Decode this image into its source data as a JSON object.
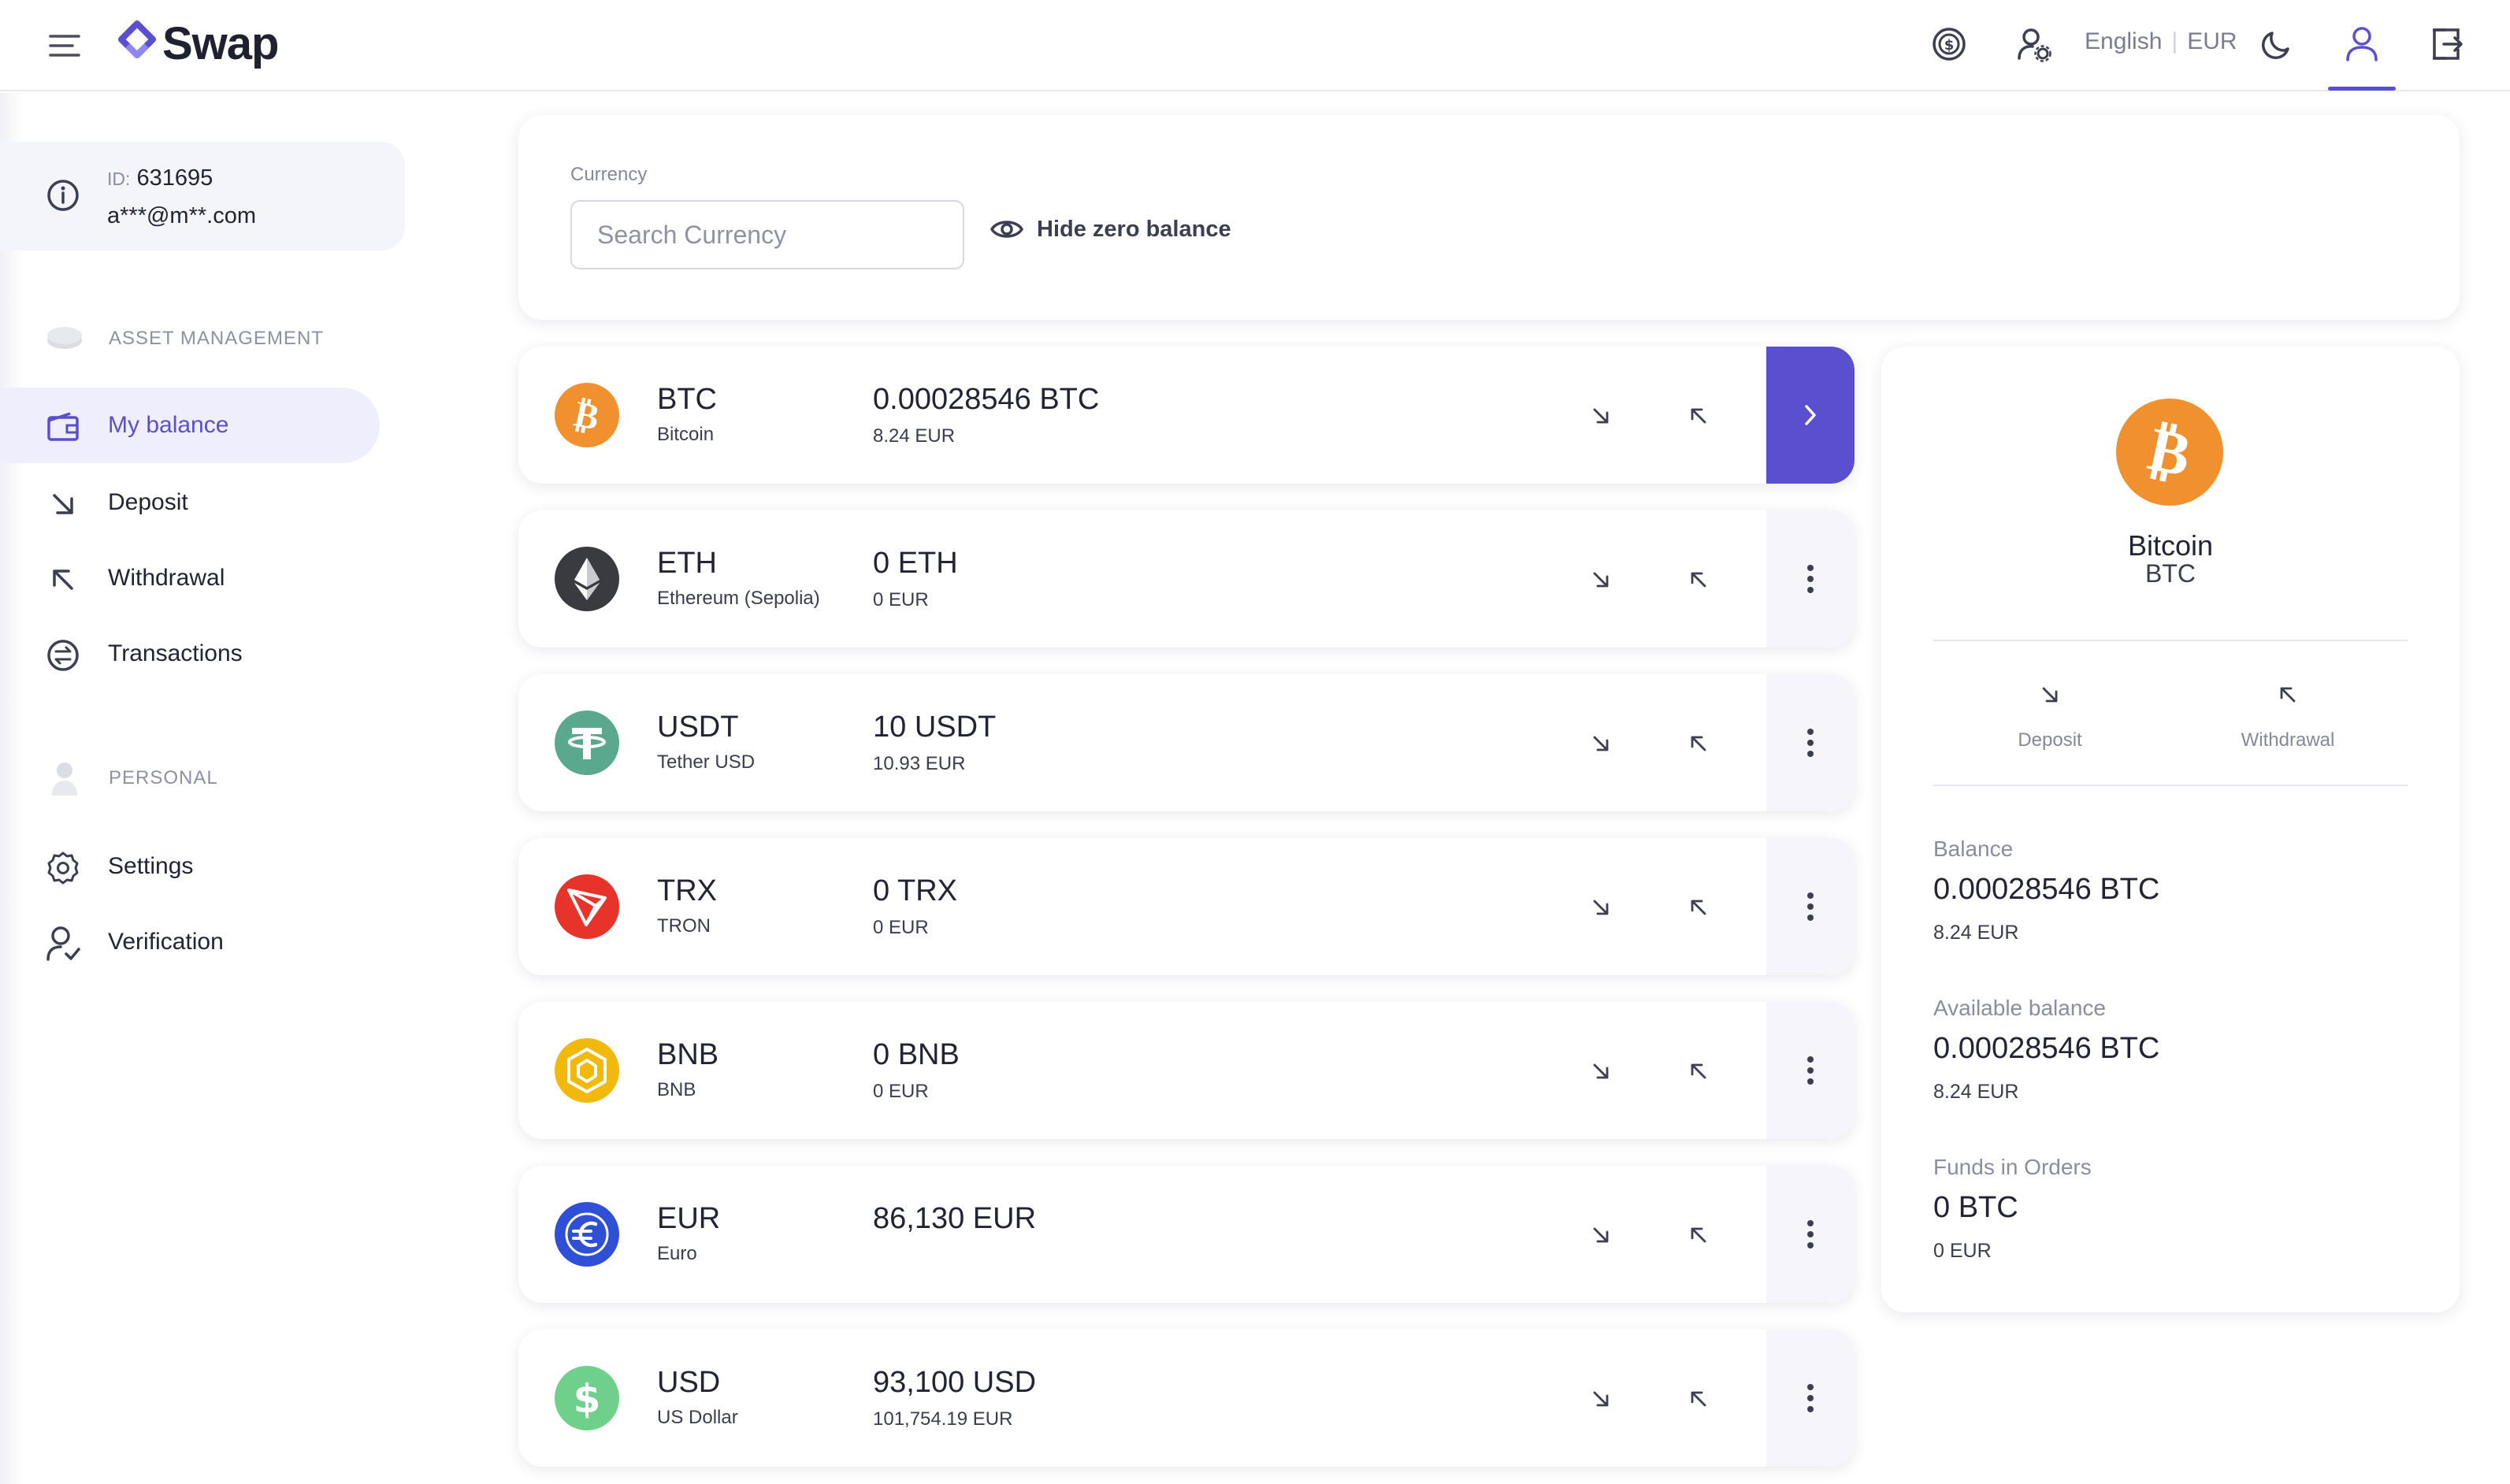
{
  "brand": {
    "name": "Swap",
    "accent": "#5a4fcf"
  },
  "header": {
    "language": "English",
    "currency": "EUR"
  },
  "user": {
    "id_label": "ID:",
    "id": "631695",
    "email": "a***@m**.com"
  },
  "sidebar": {
    "asset_section": "ASSET MANAGEMENT",
    "personal_section": "PERSONAL",
    "items": [
      {
        "label": "My balance",
        "icon": "wallet-icon",
        "active": true
      },
      {
        "label": "Deposit",
        "icon": "arrow-down-right-icon"
      },
      {
        "label": "Withdrawal",
        "icon": "arrow-up-left-icon"
      },
      {
        "label": "Transactions",
        "icon": "exchange-icon"
      },
      {
        "label": "Settings",
        "icon": "gear-icon"
      },
      {
        "label": "Verification",
        "icon": "user-check-icon"
      }
    ]
  },
  "filter": {
    "currency_label": "Currency",
    "search_placeholder": "Search Currency",
    "hide_zero_label": "Hide zero balance"
  },
  "assets": [
    {
      "symbol": "BTC",
      "name": "Bitcoin",
      "amount": "0.00028546 BTC",
      "fiat": "8.24 EUR",
      "color": "#f0902f",
      "selected": true
    },
    {
      "symbol": "ETH",
      "name": "Ethereum (Sepolia)",
      "amount": "0 ETH",
      "fiat": "0 EUR",
      "color": "#3a3b40"
    },
    {
      "symbol": "USDT",
      "name": "Tether USD",
      "amount": "10 USDT",
      "fiat": "10.93 EUR",
      "color": "#5aa88e"
    },
    {
      "symbol": "TRX",
      "name": "TRON",
      "amount": "0 TRX",
      "fiat": "0 EUR",
      "color": "#e8332a"
    },
    {
      "symbol": "BNB",
      "name": "BNB",
      "amount": "0 BNB",
      "fiat": "0 EUR",
      "color": "#f0b90b"
    },
    {
      "symbol": "EUR",
      "name": "Euro",
      "amount": "86,130 EUR",
      "fiat": "",
      "color": "#2f4fd6"
    },
    {
      "symbol": "USD",
      "name": "US Dollar",
      "amount": "93,100 USD",
      "fiat": "101,754.19 EUR",
      "color": "#6fd08c"
    }
  ],
  "detail": {
    "name": "Bitcoin",
    "symbol": "BTC",
    "deposit_label": "Deposit",
    "withdrawal_label": "Withdrawal",
    "balance_label": "Balance",
    "balance": "0.00028546 BTC",
    "balance_fiat": "8.24 EUR",
    "available_label": "Available balance",
    "available": "0.00028546 BTC",
    "available_fiat": "8.24 EUR",
    "orders_label": "Funds in Orders",
    "orders": "0 BTC",
    "orders_fiat": "0 EUR"
  }
}
